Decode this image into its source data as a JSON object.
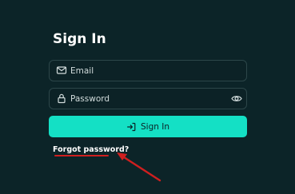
{
  "form": {
    "title": "Sign In",
    "email": {
      "placeholder": "Email",
      "icon": "mail-icon"
    },
    "password": {
      "placeholder": "Password",
      "icon": "lock-icon",
      "toggle_icon": "eye-icon"
    },
    "submit": {
      "label": "Sign In",
      "icon": "sign-in-icon"
    },
    "forgot_link": "Forgot password?"
  },
  "annotation": {
    "color": "#cf1f1f",
    "icon": "arrow-pointer-icon"
  },
  "colors": {
    "background": "#0c2428",
    "accent": "#14e0c5",
    "field_border": "#2c4649"
  }
}
